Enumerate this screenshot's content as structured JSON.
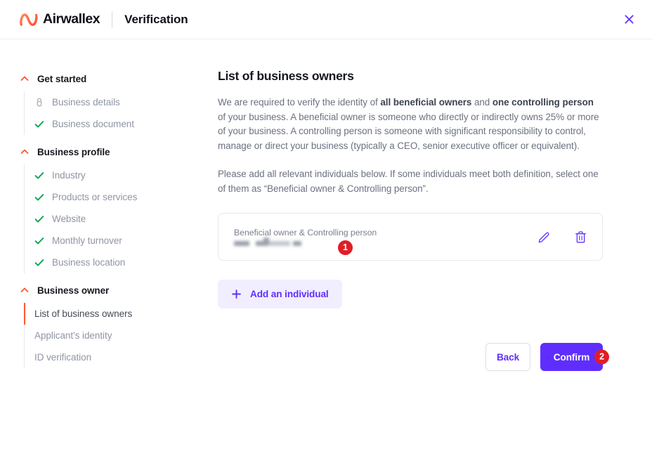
{
  "header": {
    "logo_icon": "airwallex-logo-icon",
    "brand_name": "Airwallex",
    "title": "Verification",
    "close_icon": "close-icon"
  },
  "colors": {
    "brand_orange": "#ff5733",
    "accent_purple": "#5f2eff",
    "accent_purple_light": "#f1eeff",
    "check_green": "#0fa958",
    "badge_red": "#e11d26",
    "muted_text": "#8f95a3"
  },
  "sidebar": {
    "groups": [
      {
        "title": "Get started",
        "chevron_icon": "chevron-up-icon",
        "items": [
          {
            "label": "Business details",
            "icon": "lock-icon",
            "state": "locked",
            "active": false
          },
          {
            "label": "Business document",
            "icon": "check-icon",
            "state": "complete",
            "active": false
          }
        ]
      },
      {
        "title": "Business profile",
        "chevron_icon": "chevron-up-icon",
        "items": [
          {
            "label": "Industry",
            "icon": "check-icon",
            "state": "complete",
            "active": false
          },
          {
            "label": "Products or services",
            "icon": "check-icon",
            "state": "complete",
            "active": false
          },
          {
            "label": "Website",
            "icon": "check-icon",
            "state": "complete",
            "active": false
          },
          {
            "label": "Monthly turnover",
            "icon": "check-icon",
            "state": "complete",
            "active": false
          },
          {
            "label": "Business location",
            "icon": "check-icon",
            "state": "complete",
            "active": false
          }
        ]
      },
      {
        "title": "Business owner",
        "chevron_icon": "chevron-up-icon",
        "items": [
          {
            "label": "List of business owners",
            "icon": "none",
            "state": "current",
            "active": true
          },
          {
            "label": "Applicant's identity",
            "icon": "none",
            "state": "pending",
            "active": false
          },
          {
            "label": "ID verification",
            "icon": "none",
            "state": "pending",
            "active": false
          }
        ]
      }
    ]
  },
  "main": {
    "title": "List of business owners",
    "paragraph1": {
      "part1": "We are required to verify the identity of ",
      "bold1": "all beneficial owners",
      "part2": " and ",
      "bold2": "one controlling person",
      "part3": " of your business. A beneficial owner is someone who directly or indirectly owns 25% or more of your business. A controlling person is someone with significant responsibility to control, manage or direct your business (typically a CEO, senior executive officer or equivalent)."
    },
    "paragraph2": "Please add all relevant individuals below. If some individuals meet both definition, select one of them as “Beneficial owner & Controlling person”.",
    "owner_card": {
      "role": "Beneficial owner & Controlling person",
      "name": "",
      "name_redacted": true,
      "edit_icon": "pencil-edit-icon",
      "delete_icon": "trash-delete-icon",
      "badge": "1"
    },
    "add_button": {
      "label": "Add an individual",
      "icon": "plus-icon"
    },
    "footer": {
      "back_label": "Back",
      "confirm_label": "Confirm",
      "confirm_badge": "2"
    }
  }
}
